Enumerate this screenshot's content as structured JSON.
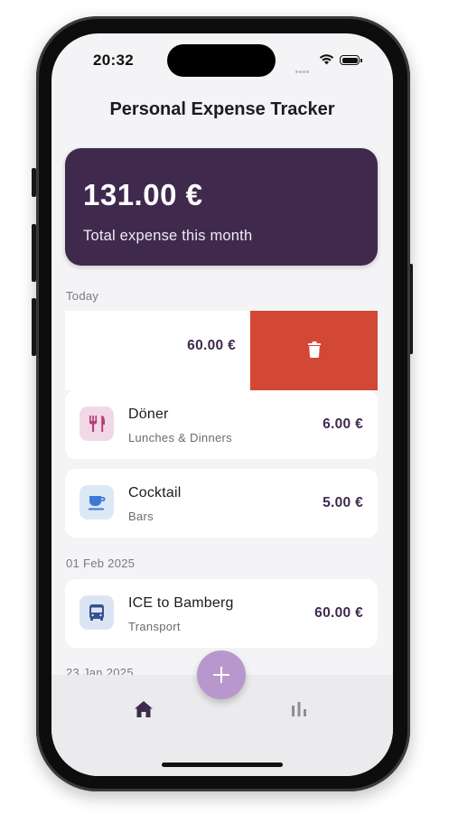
{
  "status_bar": {
    "time": "20:32"
  },
  "header": {
    "title": "Personal Expense Tracker"
  },
  "summary": {
    "amount": "131.00 €",
    "label": "Total expense this month"
  },
  "sections": [
    {
      "label": "Today"
    },
    {
      "label": "01 Feb 2025"
    },
    {
      "label": "23 Jan 2025"
    }
  ],
  "swiped_item": {
    "amount": "60.00 €",
    "action_icon": "trash-icon"
  },
  "expenses": [
    {
      "title": "Döner",
      "category": "Lunches & Dinners",
      "amount": "6.00 €",
      "icon": "restaurant-icon",
      "icon_bg": "#f0d9e5",
      "icon_color": "#b83e78"
    },
    {
      "title": "Cocktail",
      "category": "Bars",
      "amount": "5.00 €",
      "icon": "coffee-cup-icon",
      "icon_bg": "#dde8f7",
      "icon_color": "#3f79d6"
    },
    {
      "title": "ICE to Bamberg",
      "category": "Transport",
      "amount": "60.00 €",
      "icon": "bus-icon",
      "icon_bg": "#dbe4f2",
      "icon_color": "#33518f"
    }
  ],
  "nav": {
    "items": [
      {
        "icon": "home-icon"
      },
      {
        "icon": "bar-chart-icon"
      }
    ],
    "fab_icon": "plus-icon"
  },
  "colors": {
    "primary": "#3f2a4e",
    "delete": "#d34735",
    "fab": "#b898cc"
  }
}
